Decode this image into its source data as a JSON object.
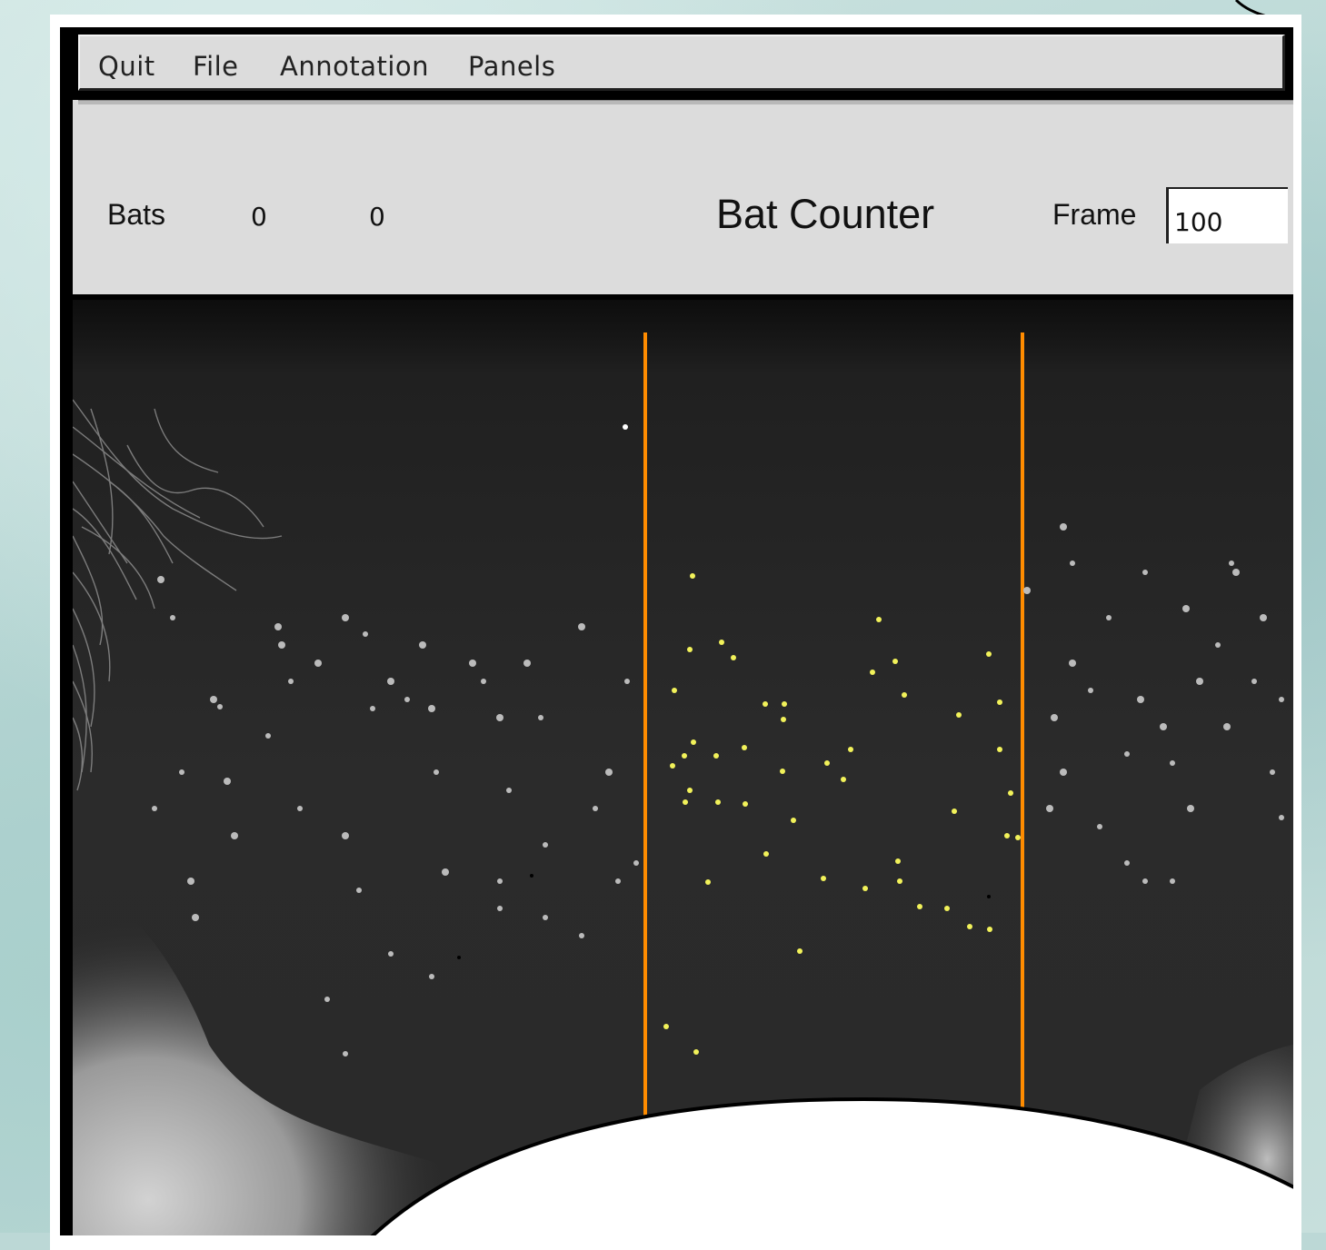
{
  "menu": {
    "items": [
      {
        "label": "Quit"
      },
      {
        "label": "File"
      },
      {
        "label": "Annotation"
      },
      {
        "label": "Panels"
      }
    ]
  },
  "panel": {
    "bats_label": "Bats",
    "count_left": "0",
    "count_right": "0",
    "title": "Bat Counter",
    "frame_label": "Frame",
    "frame_value": "100"
  },
  "colors": {
    "window_bg": "#dcdcdc",
    "count_line": "#ff8c00",
    "bat_highlight": "#f2f25a",
    "sky": "#2a2a2a"
  }
}
